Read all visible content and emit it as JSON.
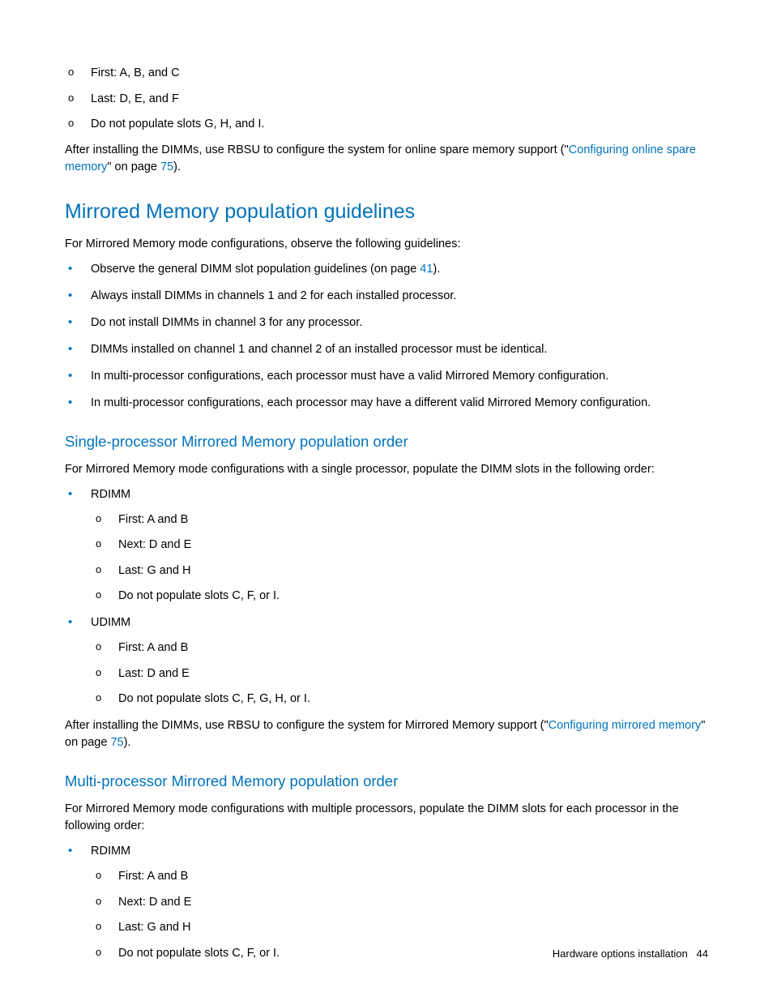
{
  "top_sublist": [
    "First: A, B, and C",
    "Last: D, E, and F",
    "Do not populate slots G, H, and I."
  ],
  "para1_pre": "After installing the DIMMs, use RBSU to configure the system for online spare memory support (\"",
  "para1_link": "Configuring online spare memory",
  "para1_mid": "\" on page ",
  "para1_page": "75",
  "para1_end": ").",
  "h2": "Mirrored Memory population guidelines",
  "para2": "For Mirrored Memory mode configurations, observe the following guidelines:",
  "guidelines": [
    {
      "pre": "Observe the general DIMM slot population guidelines (on page ",
      "link": "41",
      "post": ")."
    },
    {
      "text": "Always install DIMMs in channels 1 and 2 for each installed processor."
    },
    {
      "text": "Do not install DIMMs in channel 3 for any processor."
    },
    {
      "text": "DIMMs installed on channel 1 and channel 2 of an installed processor must be identical."
    },
    {
      "text": "In multi-processor configurations, each processor must have a valid Mirrored Memory configuration."
    },
    {
      "text": "In multi-processor configurations, each processor may have a different valid Mirrored Memory configuration."
    }
  ],
  "h3a": "Single-processor Mirrored Memory population order",
  "para3": "For Mirrored Memory mode configurations with a single processor, populate the DIMM slots in the following order:",
  "sp_list": [
    {
      "label": "RDIMM",
      "items": [
        "First: A and B",
        "Next: D and E",
        "Last: G and H",
        "Do not populate slots C, F, or I."
      ]
    },
    {
      "label": "UDIMM",
      "items": [
        "First: A and B",
        "Last: D and E",
        "Do not populate slots C, F, G, H, or I."
      ]
    }
  ],
  "para4_pre": "After installing the DIMMs, use RBSU to configure the system for Mirrored Memory support (\"",
  "para4_link": "Configuring mirrored memory",
  "para4_mid": "\" on page ",
  "para4_page": "75",
  "para4_end": ").",
  "h3b": "Multi-processor Mirrored Memory population order",
  "para5": "For Mirrored Memory mode configurations with multiple processors, populate the DIMM slots for each processor in the following order:",
  "mp_list": [
    {
      "label": "RDIMM",
      "items": [
        "First: A and B",
        "Next: D and E",
        "Last: G and H",
        "Do not populate slots C, F, or I."
      ]
    }
  ],
  "footer_text": "Hardware options installation",
  "footer_page": "44"
}
